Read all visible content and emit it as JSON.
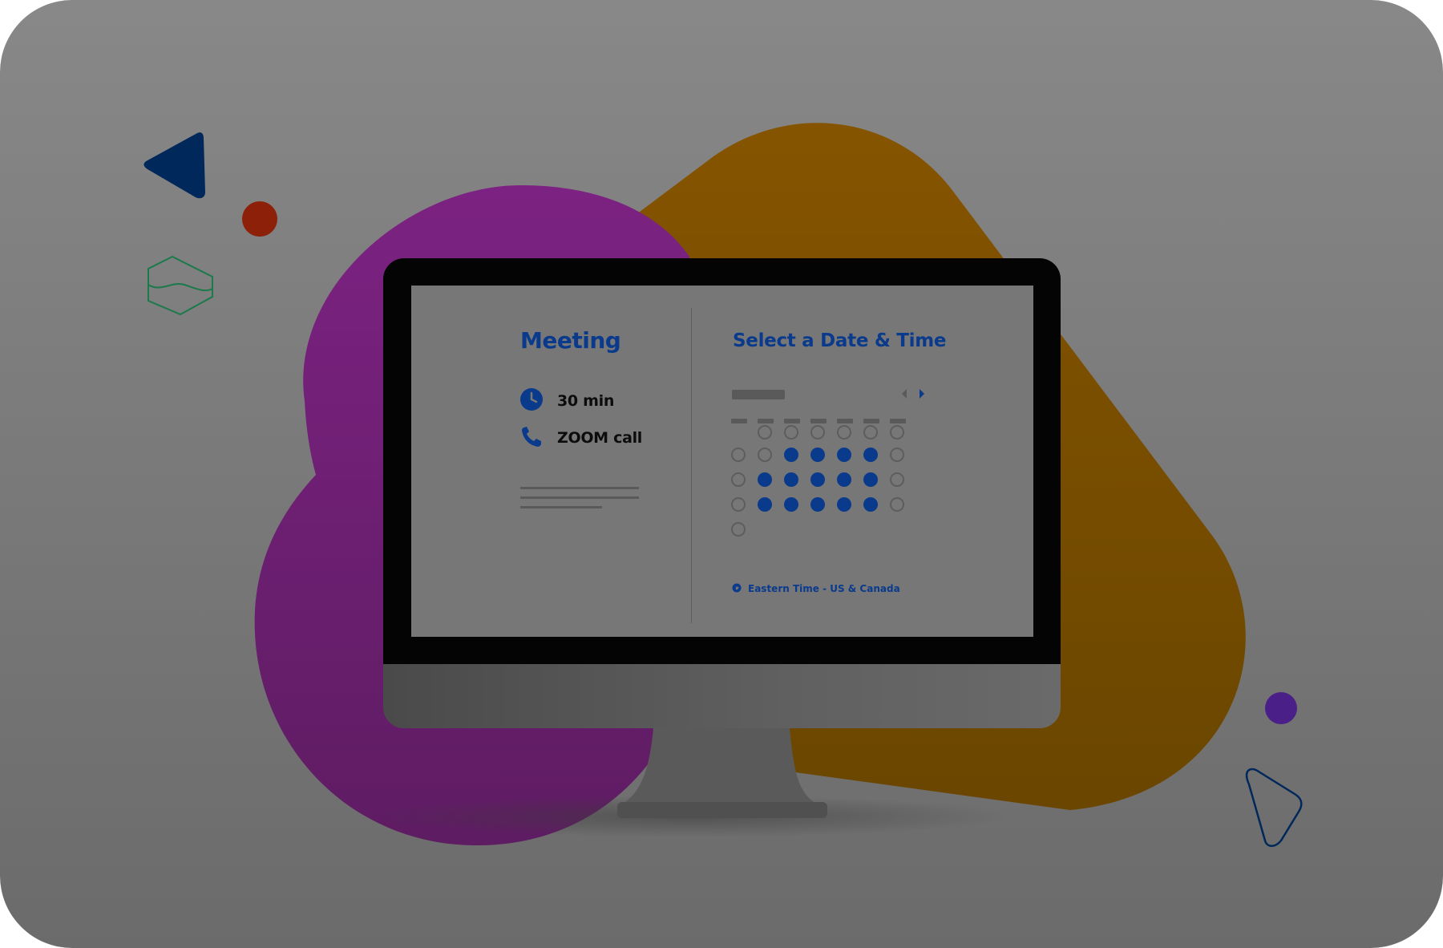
{
  "meeting": {
    "title": "Meeting",
    "duration": "30 min",
    "location": "ZOOM call"
  },
  "scheduler": {
    "title": "Select a Date & Time",
    "timezone": "Eastern Time - US & Canada"
  },
  "calendar": {
    "weeks": [
      [
        "empty",
        "unavailable",
        "unavailable",
        "unavailable",
        "unavailable",
        "unavailable",
        "unavailable"
      ],
      [
        "unavailable",
        "unavailable",
        "available",
        "available",
        "available",
        "available",
        "unavailable"
      ],
      [
        "unavailable",
        "available",
        "available",
        "available",
        "available",
        "available",
        "unavailable"
      ],
      [
        "unavailable",
        "available",
        "available",
        "available",
        "available",
        "available",
        "unavailable"
      ],
      [
        "unavailable",
        "empty",
        "empty",
        "empty",
        "empty",
        "empty",
        "empty"
      ]
    ]
  },
  "icons": {
    "duration": "clock-icon",
    "location": "phone-icon",
    "timezone": "globe-icon",
    "prev": "chevron-left-icon",
    "next": "chevron-right-icon"
  },
  "colors": {
    "accent": "#0a3a8c",
    "blob_purple": "#782080",
    "blob_orange": "#7d5000",
    "navy_triangle": "#00285a",
    "red_dot": "#8c2008",
    "purple_dot": "#4a2088",
    "green_outline": "#1a7a4a"
  }
}
